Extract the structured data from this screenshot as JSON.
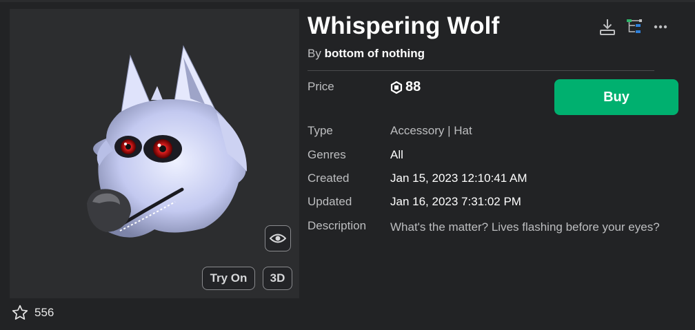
{
  "item": {
    "title": "Whispering Wolf",
    "by_prefix": "By",
    "creator": "bottom of nothing",
    "favorites": "556"
  },
  "preview": {
    "try_on_label": "Try On",
    "view3d_label": "3D",
    "eye_icon": "eye-icon"
  },
  "actions": {
    "download_icon": "download-icon",
    "tree_icon": "hierarchy-icon",
    "more_icon": "more-icon"
  },
  "details": {
    "price_label": "Price",
    "price_value": "88",
    "currency_icon": "robux-icon",
    "buy_label": "Buy",
    "type_label": "Type",
    "type_value": "Accessory | Hat",
    "genres_label": "Genres",
    "genres_value": "All",
    "created_label": "Created",
    "created_value": "Jan 15, 2023 12:10:41 AM",
    "updated_label": "Updated",
    "updated_value": "Jan 16, 2023 7:31:02 PM",
    "description_label": "Description",
    "description_value": "What's the matter? Lives flashing before your eyes?"
  },
  "colors": {
    "background": "#222325",
    "panel": "#2c2d2f",
    "buy_green": "#00b06f",
    "muted_text": "#bdbec0"
  }
}
